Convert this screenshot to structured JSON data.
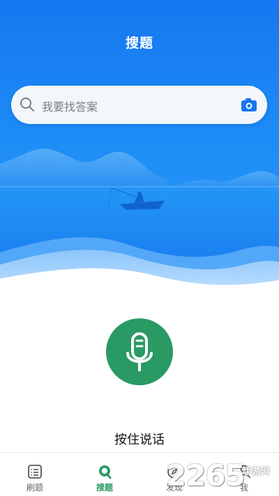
{
  "header": {
    "title": "搜题"
  },
  "search": {
    "placeholder": "我要找答案",
    "left_icon": "search-icon",
    "right_icon": "camera-icon"
  },
  "voice": {
    "icon": "microphone-icon",
    "label": "按住说话"
  },
  "tabbar": {
    "items": [
      {
        "label": "刷题",
        "icon": "list-icon",
        "active": false
      },
      {
        "label": "搜题",
        "icon": "search-q-icon",
        "active": true
      },
      {
        "label": "发现",
        "icon": "compass-icon",
        "active": false
      },
      {
        "label": "我",
        "icon": "person-icon",
        "active": false
      }
    ]
  },
  "watermark": {
    "number": "2265",
    "text": "手游网"
  },
  "colors": {
    "primary_blue": "#1677f0",
    "accent_green": "#2a9a64",
    "camera_blue": "#1677f0"
  }
}
